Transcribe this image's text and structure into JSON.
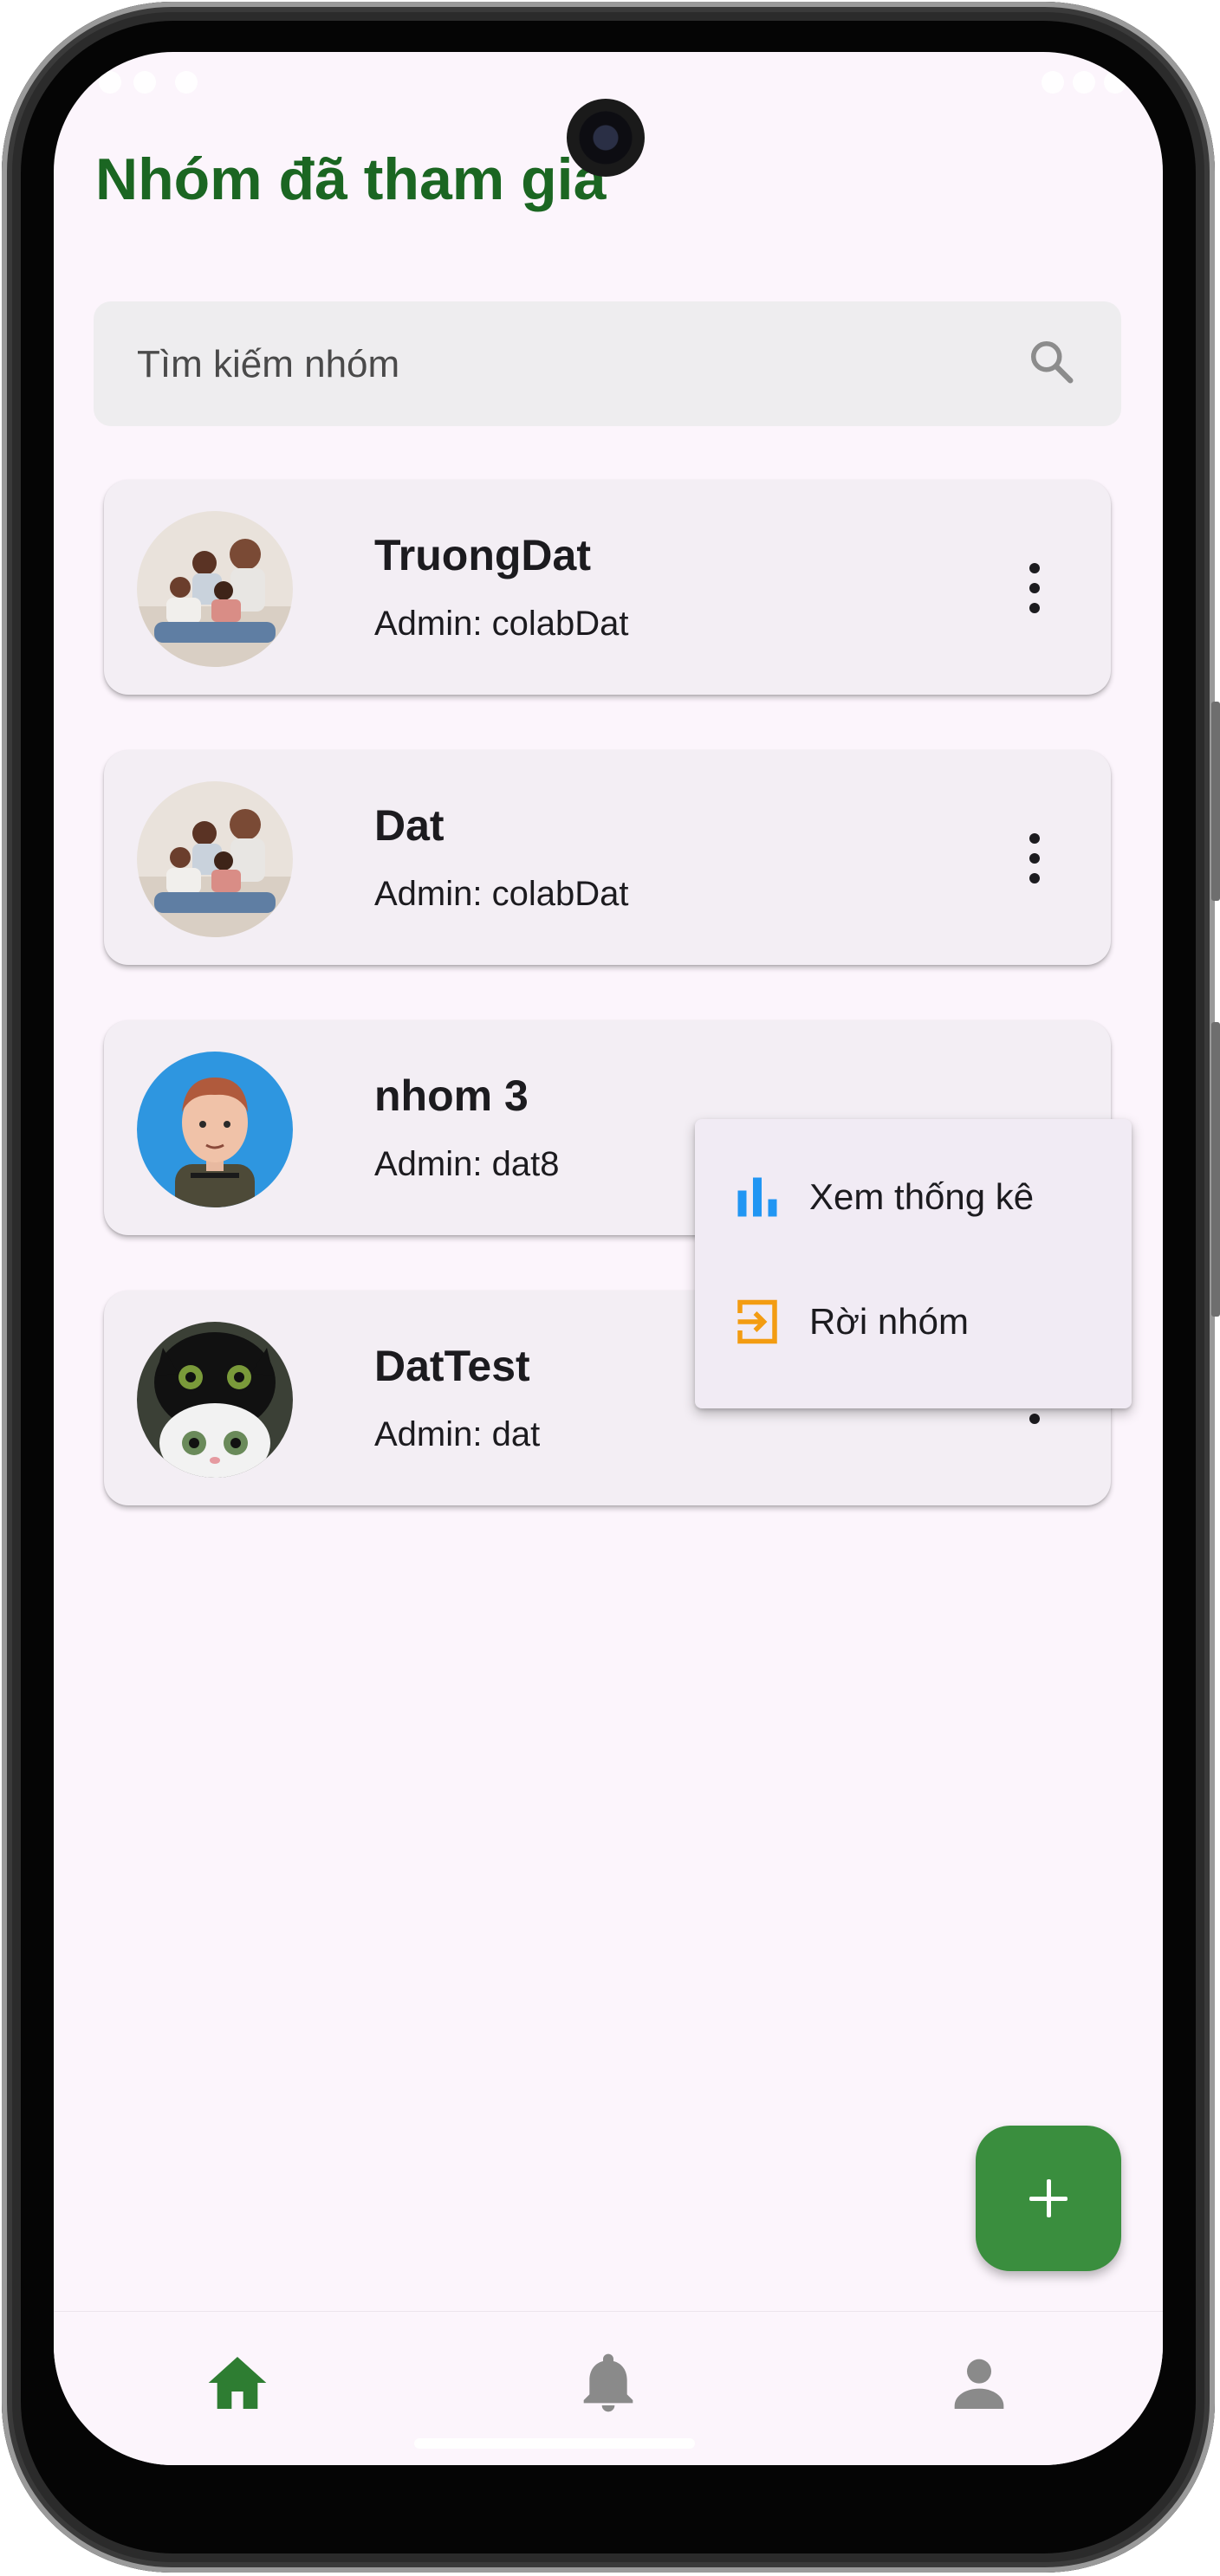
{
  "page": {
    "title": "Nhóm đã tham gia"
  },
  "search": {
    "placeholder": "Tìm kiếm nhóm",
    "icon": "search-icon"
  },
  "groups": [
    {
      "name": "TruongDat",
      "admin": "Admin: colabDat",
      "avatar": "family-photo"
    },
    {
      "name": "Dat",
      "admin": "Admin: colabDat",
      "avatar": "family-photo"
    },
    {
      "name": "nhom 3",
      "admin": "Admin: dat8",
      "avatar": "3d-character"
    },
    {
      "name": "DatTest",
      "admin": "Admin: dat",
      "avatar": "cat-photo"
    }
  ],
  "context_menu": {
    "items": [
      {
        "label": "Xem thống kê",
        "icon": "bar-chart-icon",
        "color": "#2196f3"
      },
      {
        "label": "Rời nhóm",
        "icon": "exit-icon",
        "color": "#f39c12"
      }
    ]
  },
  "fab": {
    "icon": "plus-icon"
  },
  "bottom_nav": {
    "items": [
      {
        "icon": "home-icon",
        "active": true
      },
      {
        "icon": "bell-icon",
        "active": false
      },
      {
        "icon": "person-icon",
        "active": false
      }
    ]
  },
  "colors": {
    "title": "#1b6622",
    "accent": "#3a8e3e",
    "background": "#fcf5fc",
    "card": "#f3eef4",
    "inactive_icon": "#8a8a8a"
  }
}
